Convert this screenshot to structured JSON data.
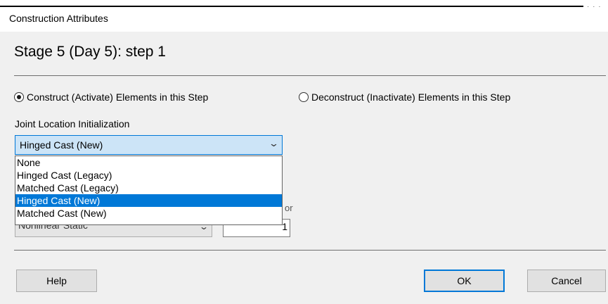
{
  "window": {
    "title": "Construction Attributes"
  },
  "heading": "Stage 5 (Day 5): step 1",
  "options": {
    "construct_label": "Construct (Activate) Elements in this Step",
    "construct_selected": true,
    "deconstruct_label": "Deconstruct (Inactivate) Elements in this Step",
    "deconstruct_selected": false
  },
  "joint": {
    "label": "Joint Location Initialization",
    "selected": "Hinged Cast (New)",
    "options": [
      "None",
      "Hinged Cast (Legacy)",
      "Matched Cast (Legacy)",
      "Hinged Cast (New)",
      "Matched Cast (New)"
    ],
    "highlighted_index": 3
  },
  "hidden_controls": {
    "analysis_type": "Nonlinear Static",
    "partial_label": "or",
    "value": "1"
  },
  "buttons": {
    "help": "Help",
    "ok": "OK",
    "cancel": "Cancel"
  },
  "icons": {
    "dropdown_arrow": "chevron-down-icon"
  },
  "colors": {
    "accent": "#0078d7",
    "combo_focus_bg": "#cce4f7"
  }
}
